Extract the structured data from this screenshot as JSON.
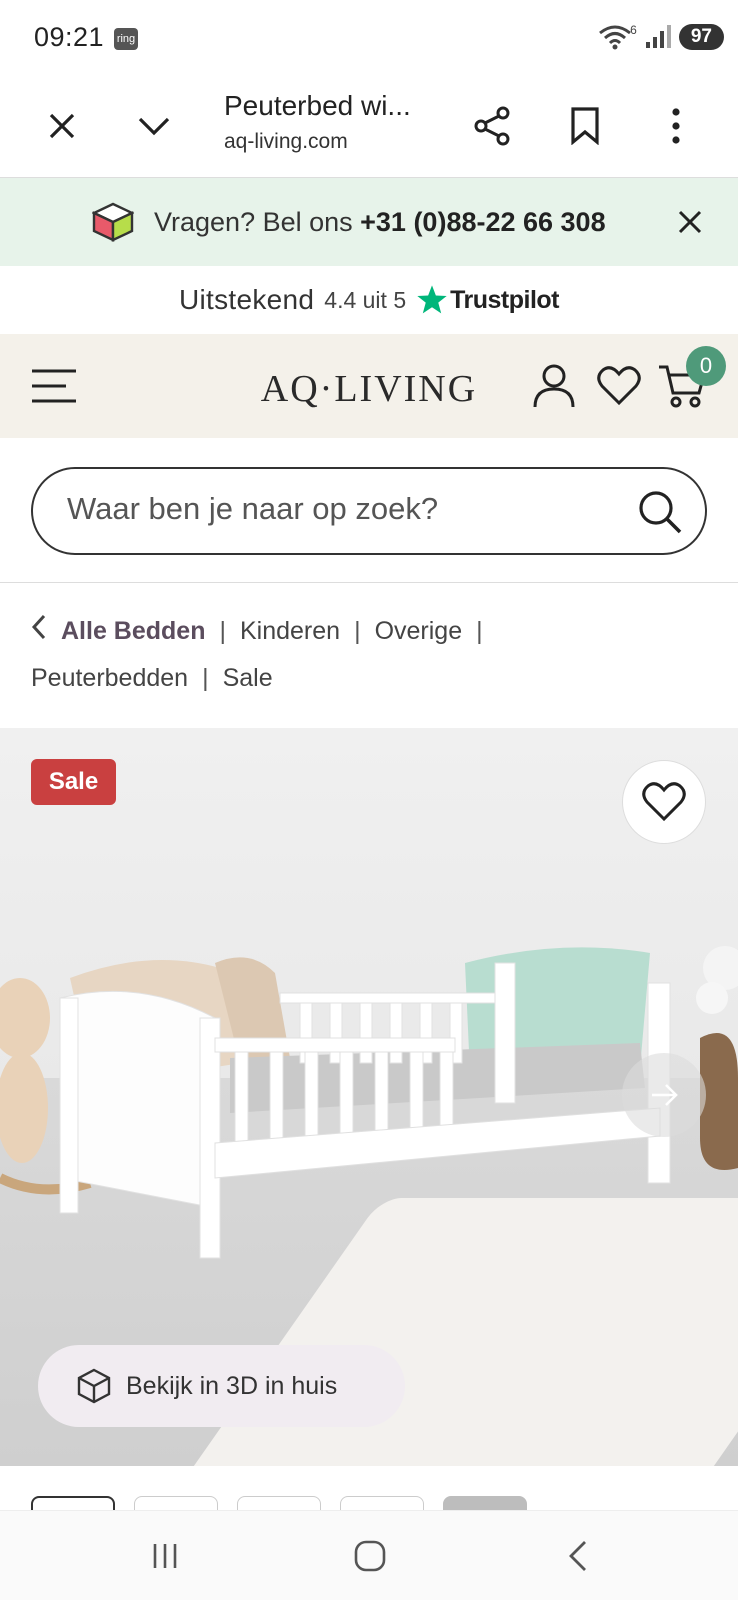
{
  "status_bar": {
    "time": "09:21",
    "ring_label": "ring",
    "battery": "97",
    "wifi_sub": "6"
  },
  "browser": {
    "title": "Peuterbed wi...",
    "url": "aq-living.com"
  },
  "info_banner": {
    "text": "Vragen? Bel ons ",
    "phone": "+31 (0)88-22 66 308"
  },
  "trustpilot": {
    "rating_word": "Uitstekend",
    "score": "4.4 uit 5",
    "brand": "Trustpilot"
  },
  "header": {
    "logo": "AQ·LIVING",
    "cart_count": "0"
  },
  "search": {
    "placeholder": "Waar ben je naar op zoek?"
  },
  "breadcrumb": {
    "items": [
      "Alle Bedden",
      "Kinderen",
      "Overige",
      "Peuterbedden",
      "Sale"
    ]
  },
  "product": {
    "badge": "Sale",
    "view_3d_label": "Bekijk in 3D in huis"
  },
  "colors": {
    "banner_bg": "#e7f3ea",
    "header_bg": "#f4f1ea",
    "sale_red": "#c94040",
    "cart_badge": "#4f9a7a",
    "trust_green": "#00b67a"
  }
}
